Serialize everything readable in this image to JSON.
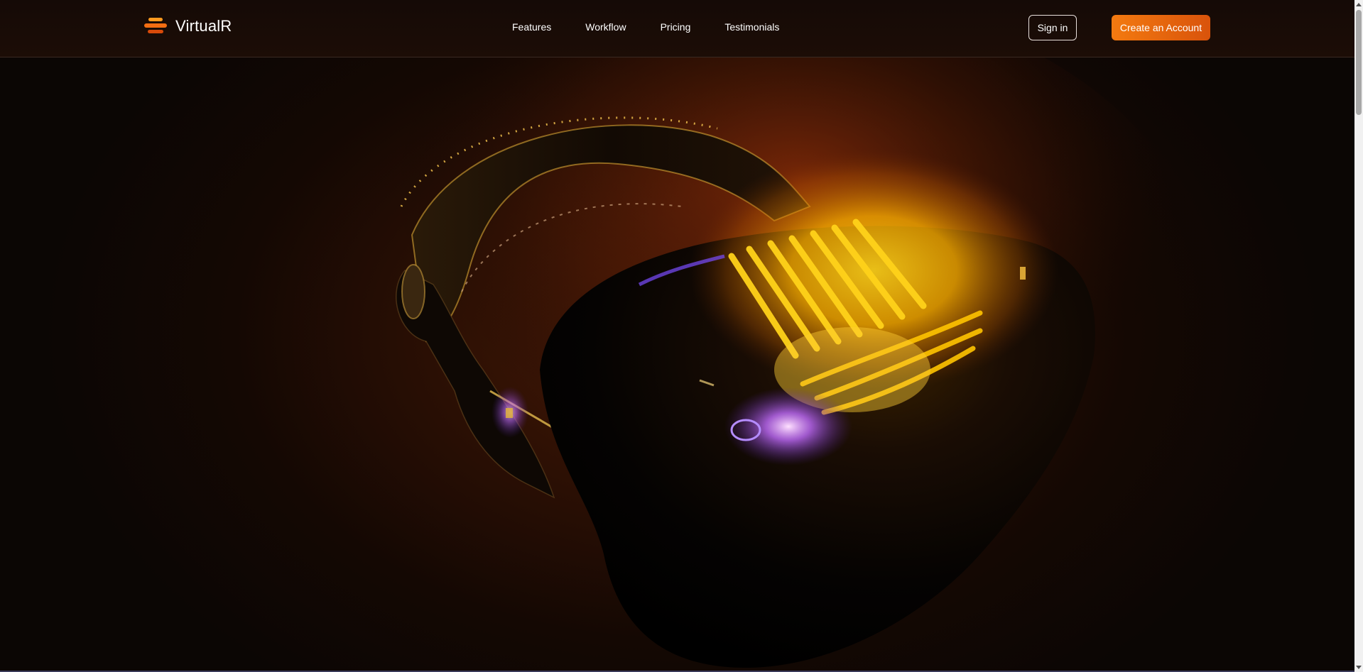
{
  "brand": {
    "name": "VirtualR",
    "logo_icon": "layered-stripes-logo-icon"
  },
  "nav": {
    "links": [
      {
        "label": "Features"
      },
      {
        "label": "Workflow"
      },
      {
        "label": "Pricing"
      },
      {
        "label": "Testimonials"
      }
    ]
  },
  "auth": {
    "signin_label": "Sign in",
    "create_account_label": "Create an Account"
  },
  "hero": {
    "image_subject": "vr-headset-illustration"
  },
  "colors": {
    "accent_orange": "#f37a10",
    "accent_orange_dark": "#d9530b",
    "glow_yellow": "#ffc400",
    "glow_purple": "#8a4dff",
    "background_dark": "#0b0604"
  }
}
